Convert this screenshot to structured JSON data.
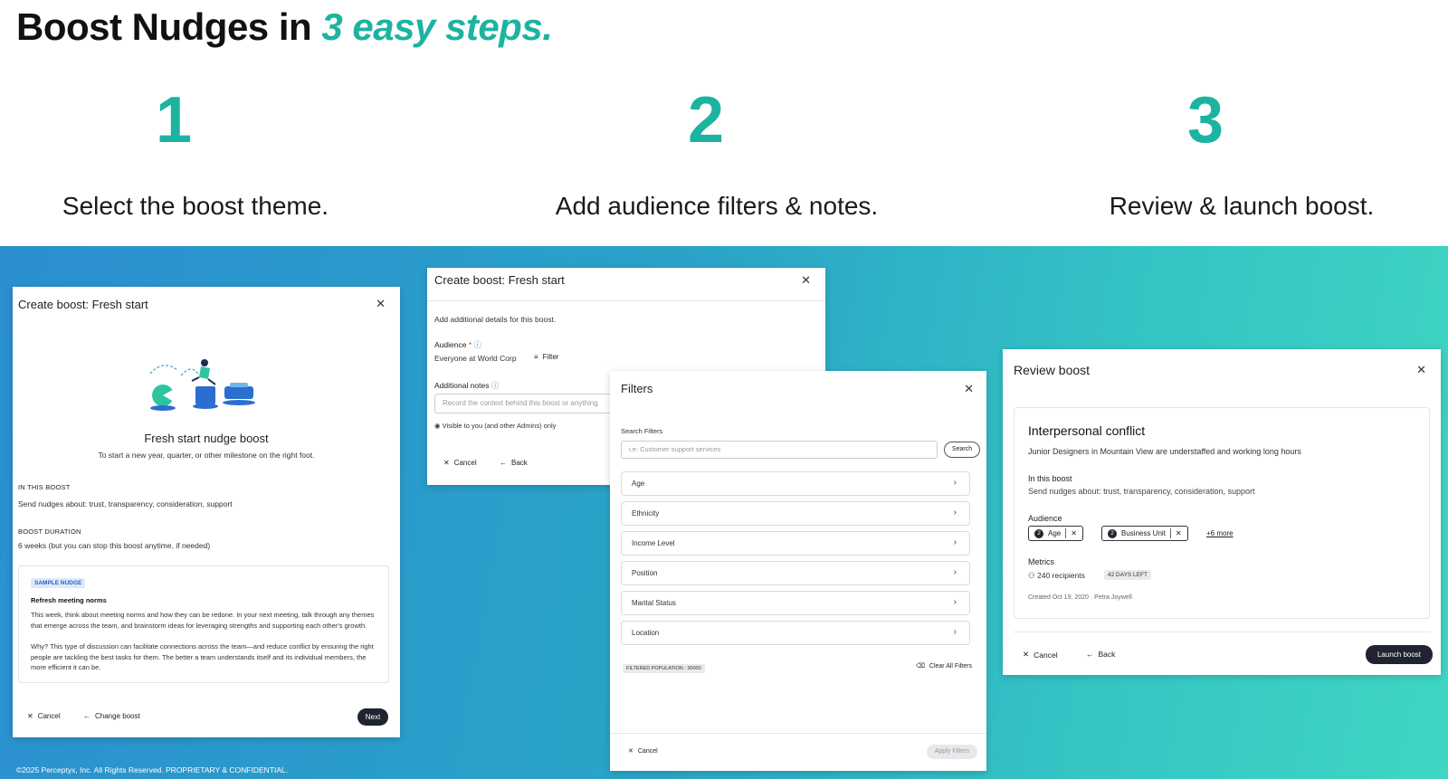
{
  "header": {
    "title_main": "Boost Nudges in ",
    "title_accent": "3 easy steps."
  },
  "steps": [
    {
      "number": "1",
      "label": "Select the boost theme."
    },
    {
      "number": "2",
      "label": "Add audience filters & notes."
    },
    {
      "number": "3",
      "label": "Review & launch boost."
    }
  ],
  "colors": {
    "accent": "#1cb3a0",
    "dark_button": "#1f2430"
  },
  "card1": {
    "title": "Create boost: Fresh start",
    "heading": "Fresh start nudge boost",
    "subheading": "To start a new year, quarter, or other milestone on the right foot.",
    "in_this_boost_label": "IN THIS BOOST",
    "in_this_boost_text": "Send nudges about: trust, transparency, consideration, support",
    "duration_label": "BOOST DURATION",
    "duration_text": "6 weeks (but you can stop this boost anytime, if needed)",
    "sample_badge": "SAMPLE NUDGE",
    "sample_title": "Refresh meeting norms",
    "sample_p1": "This week, think about meeting norms and how they can be redone. In your next meeting, talk through any themes that emerge across the team, and brainstorm ideas for leveraging strengths and supporting each other's growth.",
    "sample_p2": "Why? This type of discussion can facilitate connections across the team—and reduce conflict by ensuring the right people are tackling the best tasks for them. The better a team understands itself and its individual members, the more efficient it can be.",
    "cancel": "Cancel",
    "change": "Change boost",
    "next": "Next"
  },
  "card2": {
    "title": "Create boost: Fresh start",
    "intro": "Add additional details for this boost.",
    "audience_label": "Audience",
    "audience_value": "Everyone at World Corp",
    "filter_btn": "Filter",
    "notes_label": "Additional notes",
    "notes_placeholder": "Record the context behind this boost or anything",
    "visibility": "Visible to you (and other Admins) only",
    "cancel": "Cancel",
    "back": "Back"
  },
  "filters": {
    "title": "Filters",
    "search_label": "Search Filters",
    "search_placeholder": "i.e:  Customer support services",
    "search_btn": "Search",
    "rows": [
      "Age",
      "Ethnicity",
      "Income Level",
      "Position",
      "Marital Status",
      "Location"
    ],
    "population": "FILTERED POPULATION : 30000",
    "clear": "Clear All Filters",
    "cancel": "Cancel",
    "apply": "Apply Filters"
  },
  "card3": {
    "title": "Review boost",
    "boost_name": "Interpersonal conflict",
    "description": "Junior Designers in Mountain View are understaffed and working long hours",
    "in_this_boost_label": "In this boost",
    "in_this_boost_text": "Send nudges about: trust, transparency, consideration, support",
    "audience_label": "Audience",
    "chip1_count": "2",
    "chip1_label": "Age",
    "chip2_count": "2",
    "chip2_label": "Business Unit",
    "more": "+6 more",
    "metrics_label": "Metrics",
    "recipients": "240 recipients",
    "days_left": "42 DAYS LEFT",
    "created": "Created Oct 19, 2020  ·  Petra Joywell",
    "cancel": "Cancel",
    "back": "Back",
    "launch": "Launch boost"
  },
  "footer": {
    "copyright": "©2025 Perceptyx, Inc. All Rights Reserved. PROPRIETARY & CONFIDENTIAL."
  }
}
